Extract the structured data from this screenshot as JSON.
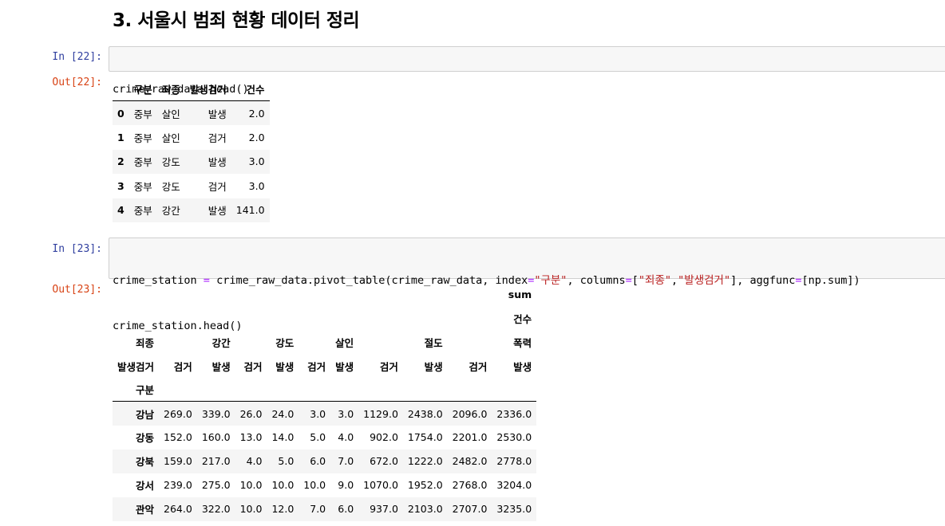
{
  "heading": "3. 서울시 범죄 현황 데이터 정리",
  "cells": [
    {
      "in_prompt": "In [22]:",
      "code": [
        "crime_raw_data.head()"
      ],
      "out_prompt": "Out[22]:"
    },
    {
      "in_prompt": "In [23]:",
      "code_parts": {
        "a": "crime_station ",
        "eq": "=",
        "b": " crime_raw_data.pivot_table(crime_raw_data, index",
        "eq2": "=",
        "s1": "\"구분\"",
        "c": ", columns",
        "eq3": "=",
        "d": "[",
        "s2": "\"죄종\"",
        "e": ",",
        "s3": "\"발생검거\"",
        "f": "], aggfunc",
        "eq4": "=",
        "g": "[np.sum])",
        "line2": "crime_station.head()"
      },
      "out_prompt": "Out[23]:"
    }
  ],
  "table1": {
    "columns": [
      "",
      "구분",
      "죄종",
      "발생검거",
      "건수"
    ],
    "rows": [
      [
        "0",
        "중부",
        "살인",
        "발생",
        "2.0"
      ],
      [
        "1",
        "중부",
        "살인",
        "검거",
        "2.0"
      ],
      [
        "2",
        "중부",
        "강도",
        "발생",
        "3.0"
      ],
      [
        "3",
        "중부",
        "강도",
        "검거",
        "3.0"
      ],
      [
        "4",
        "중부",
        "강간",
        "발생",
        "141.0"
      ]
    ]
  },
  "table2": {
    "header_rows": [
      [
        "",
        "",
        "",
        "",
        "",
        "",
        "",
        "",
        "",
        "",
        "sum"
      ],
      [
        "",
        "",
        "",
        "",
        "",
        "",
        "",
        "",
        "",
        "",
        "건수"
      ],
      [
        "죄종",
        "",
        "강간",
        "",
        "강도",
        "",
        "살인",
        "",
        "절도",
        "",
        "폭력"
      ],
      [
        "발생검거",
        "검거",
        "발생",
        "검거",
        "발생",
        "검거",
        "발생",
        "검거",
        "발생",
        "검거",
        "발생"
      ],
      [
        "구분",
        "",
        "",
        "",
        "",
        "",
        "",
        "",
        "",
        "",
        ""
      ]
    ],
    "rows": [
      [
        "강남",
        "269.0",
        "339.0",
        "26.0",
        "24.0",
        "3.0",
        "3.0",
        "1129.0",
        "2438.0",
        "2096.0",
        "2336.0"
      ],
      [
        "강동",
        "152.0",
        "160.0",
        "13.0",
        "14.0",
        "5.0",
        "4.0",
        "902.0",
        "1754.0",
        "2201.0",
        "2530.0"
      ],
      [
        "강북",
        "159.0",
        "217.0",
        "4.0",
        "5.0",
        "6.0",
        "7.0",
        "672.0",
        "1222.0",
        "2482.0",
        "2778.0"
      ],
      [
        "강서",
        "239.0",
        "275.0",
        "10.0",
        "10.0",
        "10.0",
        "9.0",
        "1070.0",
        "1952.0",
        "2768.0",
        "3204.0"
      ],
      [
        "관악",
        "264.0",
        "322.0",
        "10.0",
        "12.0",
        "7.0",
        "6.0",
        "937.0",
        "2103.0",
        "2707.0",
        "3235.0"
      ]
    ]
  }
}
